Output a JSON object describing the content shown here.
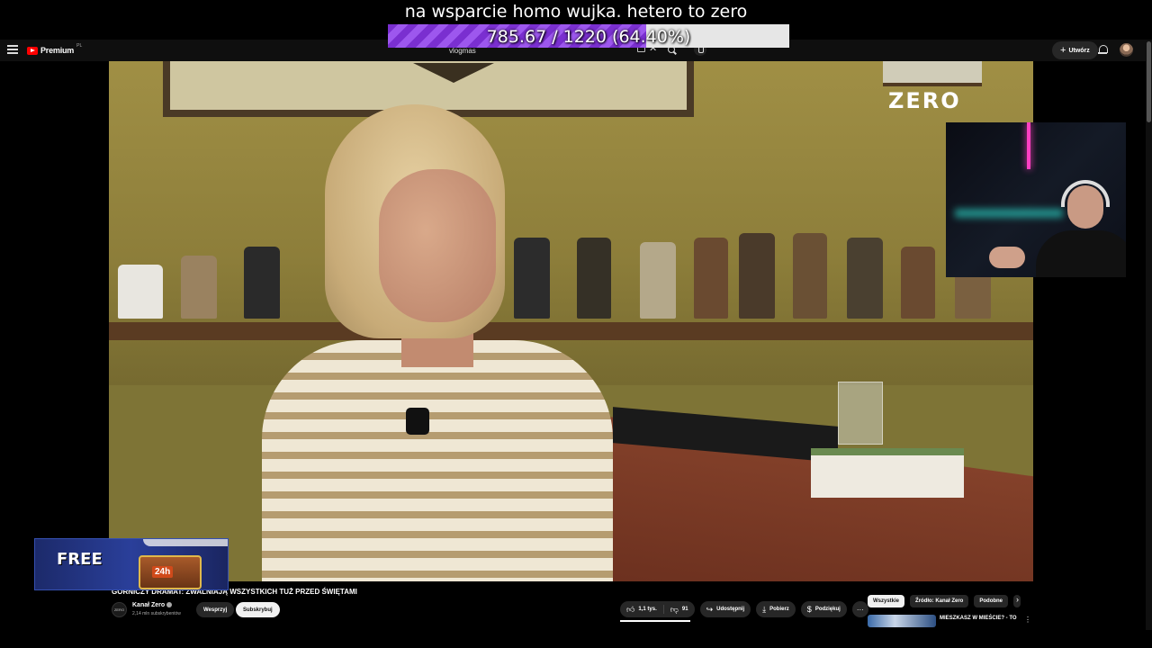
{
  "overlay": {
    "title": "na wsparcie homo wujka. hetero to zero",
    "progress_text": "785.67 / 1220 (64.40%)",
    "progress_fraction": 0.644
  },
  "header": {
    "logo": "Premium",
    "logo_sup": "PL",
    "search_value": "vlogmas",
    "create_label": "Utwórz"
  },
  "video": {
    "brand": "ZERO",
    "title": "GORNICZY DRAMAT: ZWALNIAJĄ WSZYSTKICH TUŻ PRZED ŚWIĘTAMI",
    "channel_avatar": "ZERO",
    "channel_name": "Kanał Zero",
    "subscribers": "2,14 mln subskrybentów",
    "support_label": "Wesprzyj",
    "subscribe_label": "Subskrybuj"
  },
  "actions": {
    "likes": "1,1 tys.",
    "dislikes": "91",
    "share": "Udostępnij",
    "download": "Pobierz",
    "thanks": "Podziękuj"
  },
  "ad": {
    "text": "FREE",
    "tag": "24h"
  },
  "chips": [
    "Wszystkie",
    "Źródło: Kanał Zero",
    "Podobne"
  ],
  "recommendation": {
    "title": "MIESZKASZ W MIEŚCIE? - TO"
  },
  "colors": {
    "accent_purple": "#7a2fd0",
    "youtube_red": "#ff0000",
    "background": "#0f0f0f"
  }
}
